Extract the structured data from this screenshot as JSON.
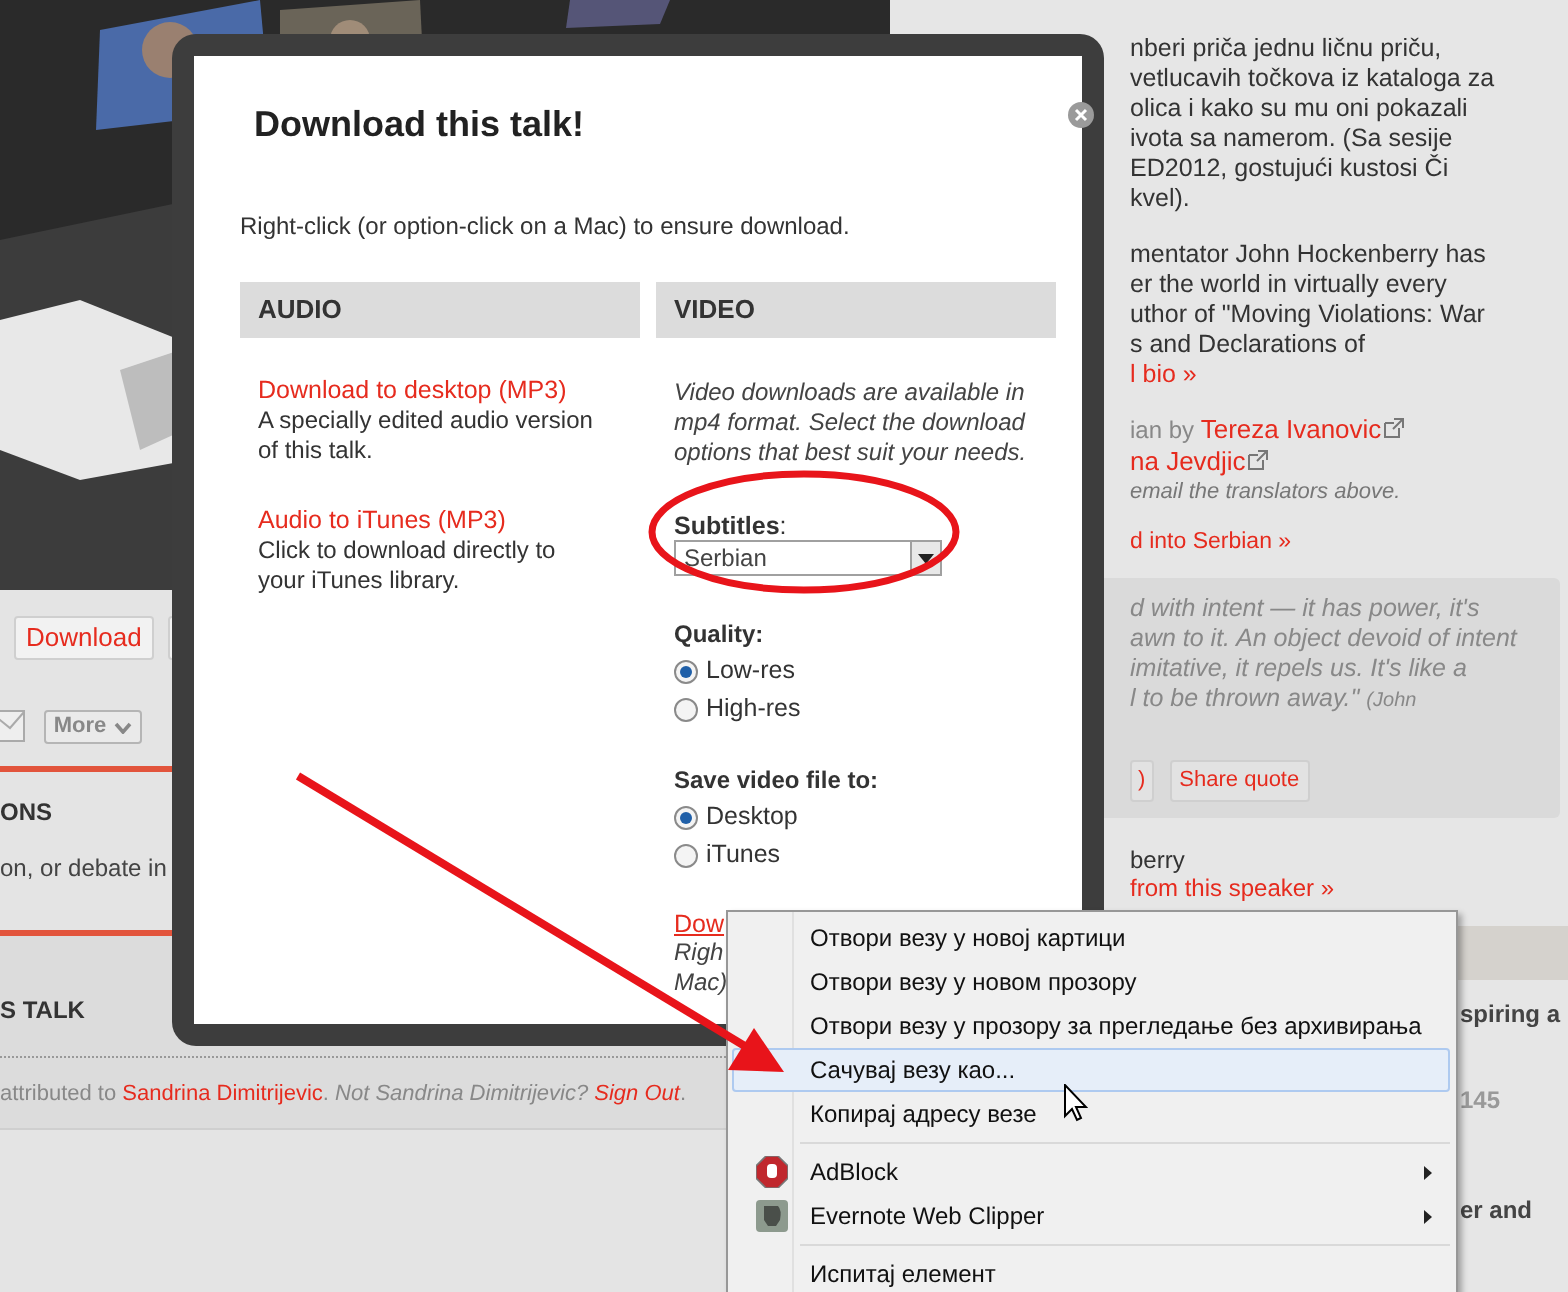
{
  "toolbar": {
    "download_button": "Download",
    "more_button": "More"
  },
  "section": {
    "heading": "ONS",
    "text": "on, or debate in"
  },
  "talk": {
    "heading": "S TALK",
    "attribution": {
      "prefix": "attributed to ",
      "name": "Sandrina Dimitrijevic",
      "middle": ". ",
      "question": "Not Sandrina Dimitrijevic? ",
      "sign_out": "Sign Out",
      "suffix": "."
    }
  },
  "sidebar": {
    "description_lines": [
      "nberi priča jednu ličnu priču,",
      "vetlucavih točkova iz kataloga za",
      "olica i kako su mu oni pokazali",
      "ivota sa namerom. (Sa sesije",
      "ED2012, gostujući kustosi Či",
      "kvel)."
    ],
    "bio_lines": [
      "mentator John Hockenberry has",
      "er the world in virtually every",
      "uthor of \"Moving Violations: War",
      "s and Declarations of"
    ],
    "bio_link": "l bio »",
    "translated_prefix": "ian by ",
    "translator_1": "Tereza Ivanovic",
    "translator_2": "na Jevdjic",
    "translators_note": "email the translators above.",
    "serbian_link": "d into Serbian »",
    "quote_lines": [
      "d with intent — it has power, it's",
      "awn to it. An object devoid of intent",
      "imitative, it repels us. It's like a",
      "l to be thrown away.\""
    ],
    "quote_author": "(John",
    "quote_button_stub": ")",
    "share_quote": "Share quote",
    "speaker": "berry",
    "speaker_link": "from this speaker »",
    "related": [
      {
        "title": "spiring a"
      },
      {
        "title": "145"
      },
      {
        "title": "er and"
      }
    ]
  },
  "modal": {
    "title": "Download this talk!",
    "instructions": "Right-click (or option-click on a Mac) to ensure download.",
    "audio": {
      "heading": "AUDIO",
      "options": [
        {
          "link": "Download to desktop (MP3)",
          "description": "A specially edited audio version of this talk."
        },
        {
          "link": "Audio to iTunes (MP3)",
          "description": "Click to download directly to your iTunes library."
        }
      ]
    },
    "video": {
      "heading": "VIDEO",
      "description": "Video downloads are available in mp4 format. Select the download options that best suit your needs.",
      "subtitles_label": "Subtitles",
      "subtitles_colon": ":",
      "subtitles_value": "Serbian",
      "quality_label": "Quality:",
      "quality": [
        {
          "label": "Low-res",
          "selected": true
        },
        {
          "label": "High-res",
          "selected": false
        }
      ],
      "save_label": "Save video file to:",
      "save_to": [
        {
          "label": "Desktop",
          "selected": true
        },
        {
          "label": "iTunes",
          "selected": false
        }
      ],
      "download_link": "Dow",
      "note_lines": [
        "Righ",
        "Mac)"
      ]
    }
  },
  "context_menu": {
    "groups": [
      [
        {
          "label": "Отвори везу у новој картици",
          "selected": false
        },
        {
          "label": "Отвори везу у новом прозору",
          "selected": false
        },
        {
          "label": "Отвори везу у прозору за прегледање без архивирања",
          "selected": false
        },
        {
          "label": "Сачувај везу као...",
          "selected": true
        },
        {
          "label": "Копирај адресу везе",
          "selected": false
        }
      ],
      [
        {
          "label": "AdBlock",
          "selected": false,
          "submenu": true
        },
        {
          "label": "Evernote Web Clipper",
          "selected": false,
          "submenu": true
        }
      ],
      [
        {
          "label": "Испитај елемент",
          "selected": false
        }
      ]
    ]
  }
}
